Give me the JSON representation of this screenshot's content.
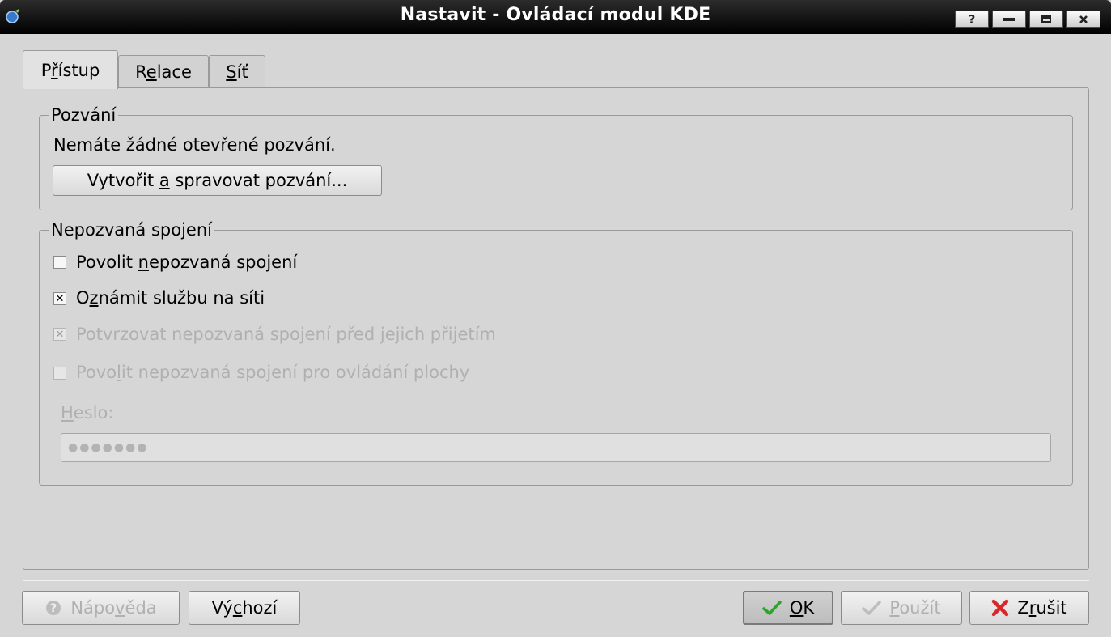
{
  "window": {
    "title": "Nastavit - Ovládací modul KDE",
    "help_glyph": "?",
    "minimize_icon": "minimize-icon",
    "maximize_icon": "maximize-icon",
    "close_icon": "close-icon"
  },
  "tabs": [
    {
      "pre": "P",
      "mnemonic": "ř",
      "post": "ístup",
      "active": true
    },
    {
      "pre": "R",
      "mnemonic": "e",
      "post": "lace",
      "active": false
    },
    {
      "pre": "",
      "mnemonic": "S",
      "post": "íť",
      "active": false
    }
  ],
  "invitations": {
    "title": "Pozvání",
    "status": "Nemáte žádné otevřené pozvání.",
    "button": {
      "pre": "Vytvořit ",
      "mnemonic": "a",
      "post": " spravovat pozvání..."
    }
  },
  "uninvited": {
    "title": "Nepozvaná spojení",
    "options": [
      {
        "pre": "Povolit ",
        "mnemonic": "n",
        "post": "epozvaná spojení",
        "checked": false,
        "enabled": true
      },
      {
        "pre": "O",
        "mnemonic": "z",
        "post": "námit službu na síti",
        "checked": true,
        "enabled": true
      },
      {
        "pre": "Potvrzovat nepozvaná spojení před ",
        "mnemonic": "j",
        "post": "ejich přijetím",
        "checked": true,
        "enabled": false
      },
      {
        "pre": "Povo",
        "mnemonic": "l",
        "post": "it nepozvaná spojení pro ovládání plochy",
        "checked": false,
        "enabled": false
      }
    ],
    "password_label": {
      "pre": "",
      "mnemonic": "H",
      "post": "eslo:"
    },
    "password_value": "●●●●●●●"
  },
  "footer": {
    "help": {
      "pre": "Nápo",
      "mnemonic": "v",
      "post": "ěda",
      "enabled": false
    },
    "defaults": {
      "pre": "Vý",
      "mnemonic": "c",
      "post": "hozí",
      "enabled": true
    },
    "ok": {
      "pre": "",
      "mnemonic": "O",
      "post": "K",
      "enabled": true
    },
    "apply": {
      "pre": "",
      "mnemonic": "P",
      "post": "oužít",
      "enabled": false
    },
    "cancel": {
      "pre": "Z",
      "mnemonic": "r",
      "post": "ušit",
      "enabled": true
    }
  },
  "colors": {
    "titlebar": "#000000",
    "window_bg": "#d6d6d6",
    "disabled_text": "#b0b0b0",
    "ok_check": "#2aa52a",
    "cancel_x": "#d9262a"
  }
}
